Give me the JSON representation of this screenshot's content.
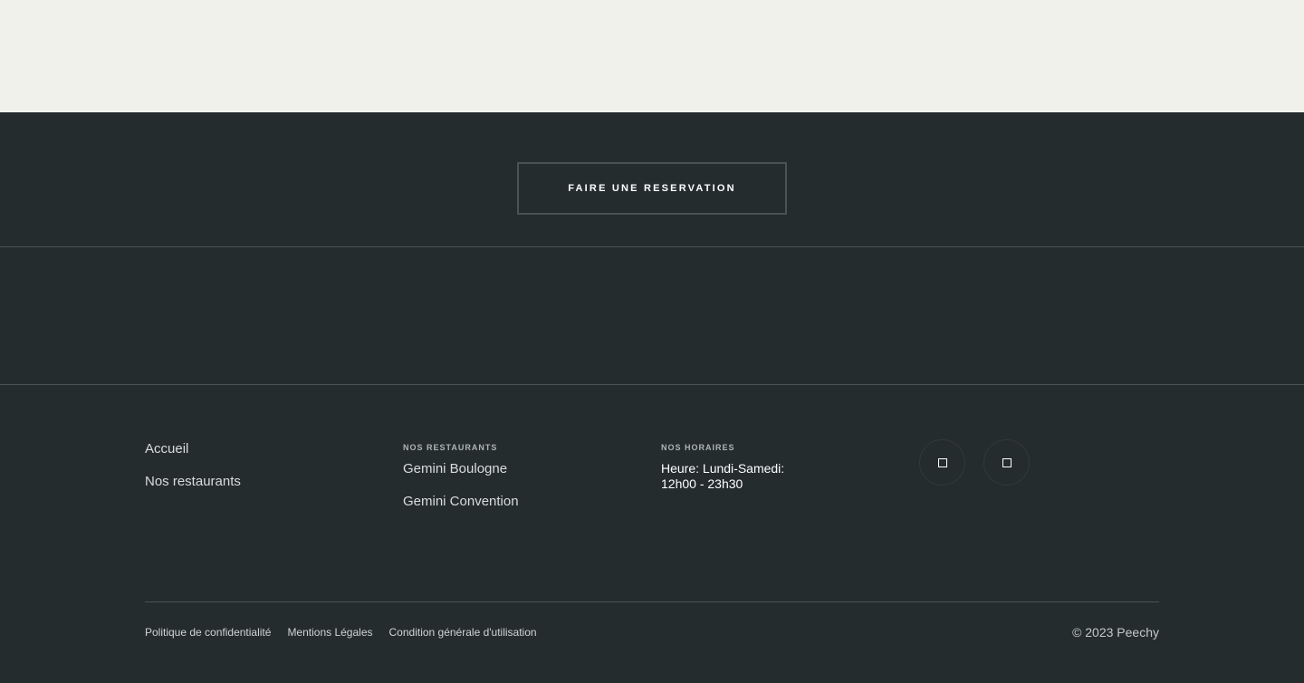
{
  "reservation": {
    "button_label": "FAIRE UNE RESERVATION"
  },
  "footer_nav": {
    "items": [
      {
        "label": "Accueil"
      },
      {
        "label": "Nos restaurants"
      }
    ]
  },
  "restaurants": {
    "heading": "NOS RESTAURANTS",
    "items": [
      {
        "label": "Gemini Boulogne"
      },
      {
        "label": "Gemini Convention"
      }
    ]
  },
  "hours": {
    "heading": "NOS HORAIRES",
    "text": "Heure: Lundi-Samedi: 12h00 - 23h30"
  },
  "social": {
    "items": [
      {
        "icon": "social-icon"
      },
      {
        "icon": "social-icon"
      }
    ]
  },
  "legal": {
    "links": [
      {
        "label": "Politique de confidentialité"
      },
      {
        "label": "Mentions Légales"
      },
      {
        "label": "Condition générale d'utilisation"
      }
    ]
  },
  "copyright": "© 2023 Peechy",
  "colors": {
    "top_band": "#f1f1ec",
    "footer_bg": "#242c2e",
    "divider": "#4b5355",
    "text_primary": "#ffffff"
  }
}
